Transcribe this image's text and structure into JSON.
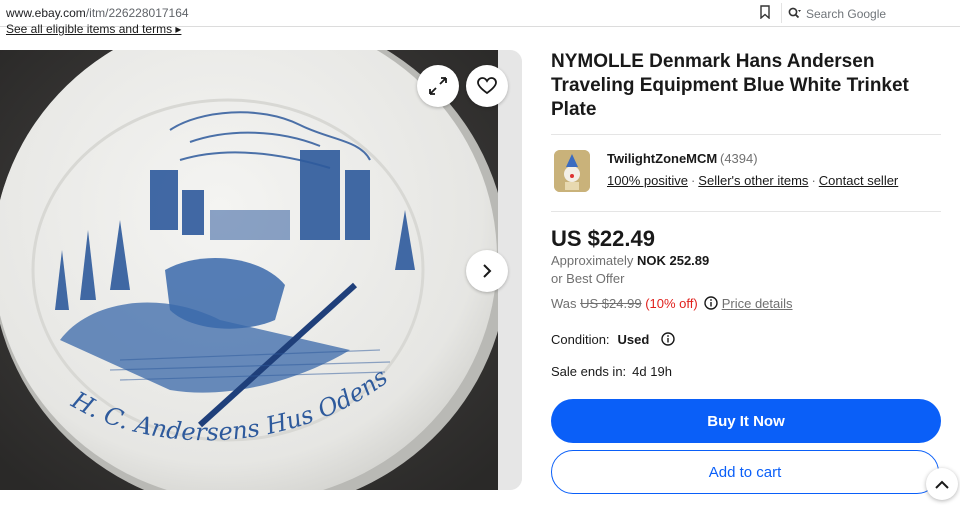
{
  "browser": {
    "url_host": "www.ebay.com",
    "url_path": "/itm/226228017164",
    "search_placeholder": "Search Google"
  },
  "top_link": "See all eligible items and terms",
  "image": {
    "plate_caption": "H. C. Andersens Hus Odense",
    "expand_icon": "expand-arrows-icon",
    "favorite_icon": "heart-icon",
    "next_icon": "chevron-right-icon"
  },
  "listing": {
    "title": "NYMOLLE Denmark Hans Andersen Traveling Equipment Blue White Trinket Plate"
  },
  "seller": {
    "name": "TwilightZoneMCM",
    "feedback_count": "(4394)",
    "positive": "100% positive",
    "other_items": "Seller's other items",
    "contact": "Contact seller"
  },
  "pricing": {
    "price": "US $22.49",
    "approx_prefix": "Approximately ",
    "approx_value": "NOK 252.89",
    "best_offer": "or Best Offer",
    "was_label": "Was ",
    "was_price": "US $24.99",
    "discount": "(10% off)",
    "details_link": "Price details"
  },
  "condition": {
    "label": "Condition:",
    "value": "Used"
  },
  "sale_ends": {
    "label": "Sale ends in:",
    "value": "4d 19h"
  },
  "buttons": {
    "buy_now": "Buy It Now",
    "add_to_cart": "Add to cart"
  },
  "colors": {
    "accent": "#0a5ff8",
    "discount": "#e0201c",
    "plate_ink": "#2e5a9c"
  }
}
